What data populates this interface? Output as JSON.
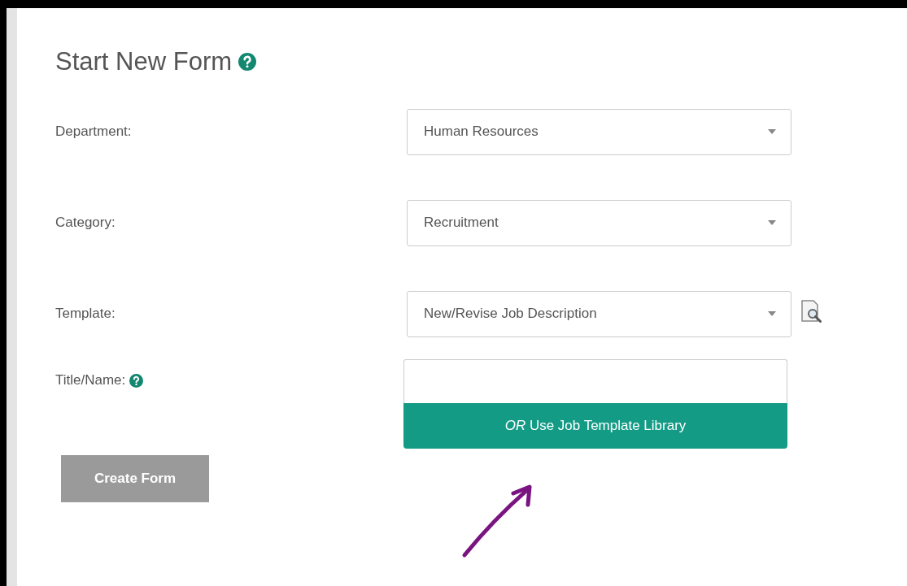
{
  "title": "Start New Form",
  "title_help": true,
  "fields": [
    {
      "kind": "select",
      "label": "Department:",
      "value": "Human Resources"
    },
    {
      "kind": "select",
      "label": "Category:",
      "value": "Recruitment"
    },
    {
      "kind": "select",
      "label": "Template:",
      "value": "New/Revise Job Description",
      "preview": true
    },
    {
      "kind": "text",
      "label": "Title/Name:",
      "help": true,
      "library_button": "*OR* Use Job Template Library"
    }
  ],
  "create_button": {
    "label": "Create Form",
    "disabled": true
  }
}
